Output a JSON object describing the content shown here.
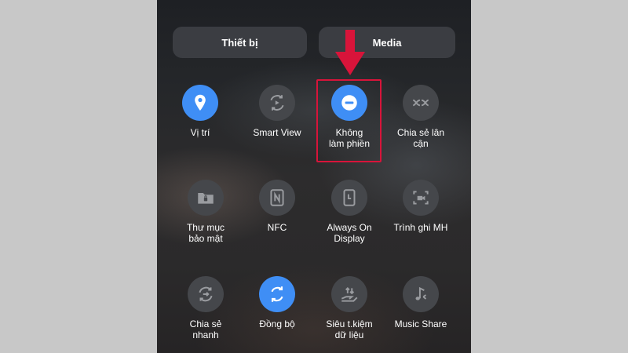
{
  "tabs": [
    {
      "label": "Thiết bị"
    },
    {
      "label": "Media"
    }
  ],
  "tiles": [
    {
      "label": "Vị trí",
      "icon": "location-icon",
      "active": true
    },
    {
      "label": "Smart View",
      "icon": "smart-view-icon",
      "active": false
    },
    {
      "label": "Không\nlàm phiền",
      "icon": "do-not-disturb-icon",
      "active": true
    },
    {
      "label": "Chia sẻ lân\ncận",
      "icon": "nearby-share-icon",
      "active": false
    },
    {
      "label": "Thư mục\nbảo mật",
      "icon": "secure-folder-icon",
      "active": false
    },
    {
      "label": "NFC",
      "icon": "nfc-icon",
      "active": false
    },
    {
      "label": "Always On\nDisplay",
      "icon": "always-on-display-icon",
      "active": false
    },
    {
      "label": "Trình ghi MH",
      "icon": "screen-recorder-icon",
      "active": false
    },
    {
      "label": "Chia sẻ\nnhanh",
      "icon": "quick-share-icon",
      "active": false
    },
    {
      "label": "Đồng bộ",
      "icon": "sync-icon",
      "active": true
    },
    {
      "label": "Siêu t.kiệm\ndữ liệu",
      "icon": "data-saver-icon",
      "active": false
    },
    {
      "label": "Music Share",
      "icon": "music-share-icon",
      "active": false
    }
  ],
  "colors": {
    "active": "#3f8ef5",
    "inactive": "#45474b",
    "highlight": "#d8143a"
  }
}
